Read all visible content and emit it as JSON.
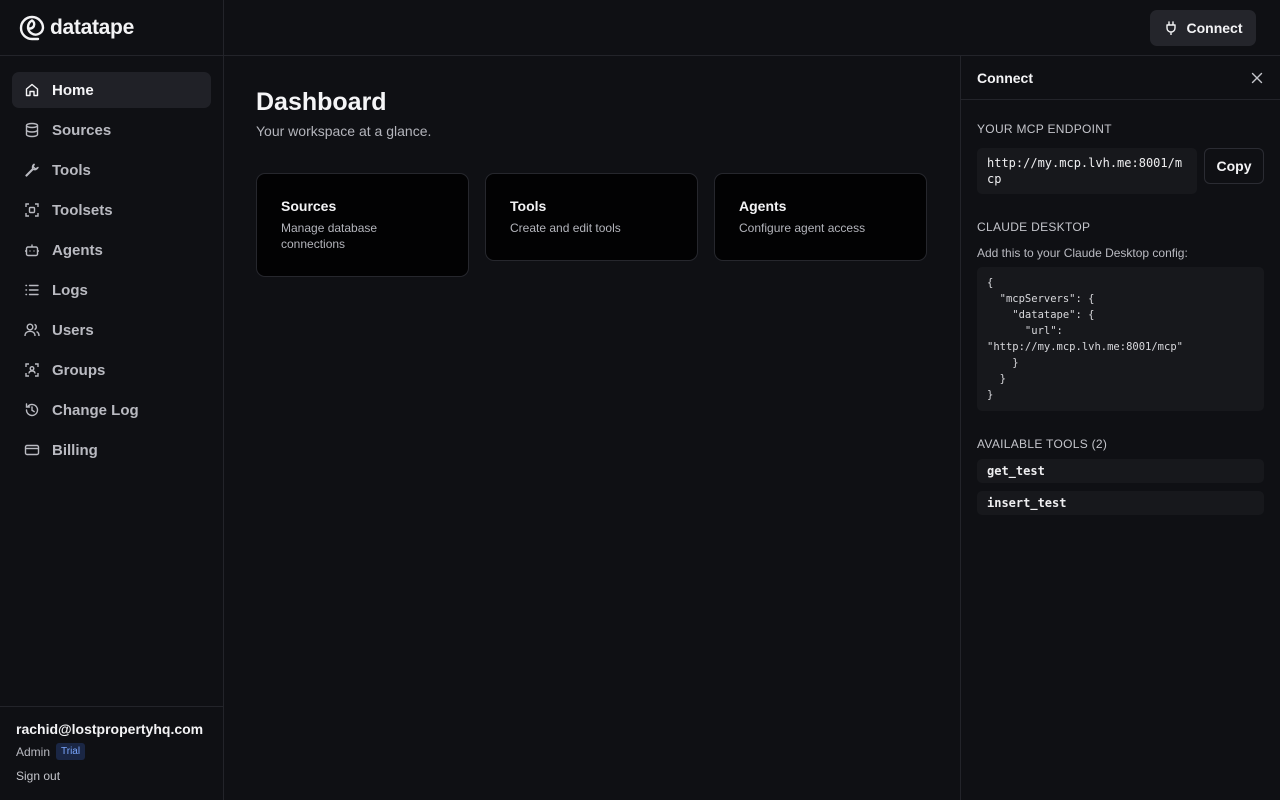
{
  "app": {
    "name": "datatape"
  },
  "sidebar": {
    "items": [
      {
        "label": "Home",
        "icon": "home-icon"
      },
      {
        "label": "Sources",
        "icon": "database-icon"
      },
      {
        "label": "Tools",
        "icon": "wrench-icon"
      },
      {
        "label": "Toolsets",
        "icon": "toolset-icon"
      },
      {
        "label": "Agents",
        "icon": "bot-icon"
      },
      {
        "label": "Logs",
        "icon": "list-icon"
      },
      {
        "label": "Users",
        "icon": "users-icon"
      },
      {
        "label": "Groups",
        "icon": "group-icon"
      },
      {
        "label": "Change Log",
        "icon": "history-icon"
      },
      {
        "label": "Billing",
        "icon": "credit-card-icon"
      }
    ],
    "active": "Home"
  },
  "user": {
    "email": "rachid@lostpropertyhq.com",
    "role": "Admin",
    "plan_badge": "Trial",
    "sign_out": "Sign out"
  },
  "topbar": {
    "connect_label": "Connect"
  },
  "main": {
    "title": "Dashboard",
    "subtitle": "Your workspace at a glance.",
    "cards": [
      {
        "title": "Sources",
        "desc": "Manage database connections"
      },
      {
        "title": "Tools",
        "desc": "Create and edit tools"
      },
      {
        "title": "Agents",
        "desc": "Configure agent access"
      }
    ]
  },
  "panel": {
    "title": "Connect",
    "endpoint_label": "YOUR MCP ENDPOINT",
    "endpoint_url": "http://my.mcp.lvh.me:8001/mcp",
    "copy_label": "Copy",
    "claude_label": "CLAUDE DESKTOP",
    "claude_hint": "Add this to your Claude Desktop config:",
    "claude_config": "{\n  \"mcpServers\": {\n    \"datatape\": {\n      \"url\":\n\"http://my.mcp.lvh.me:8001/mcp\"\n    }\n  }\n}",
    "tools_label": "AVAILABLE TOOLS (2)",
    "tools": [
      "get_test",
      "insert_test"
    ]
  },
  "colors": {
    "background": "#0f1014",
    "active_nav": "#202127",
    "card_bg": "#020203",
    "badge": "#7aa7ff"
  }
}
